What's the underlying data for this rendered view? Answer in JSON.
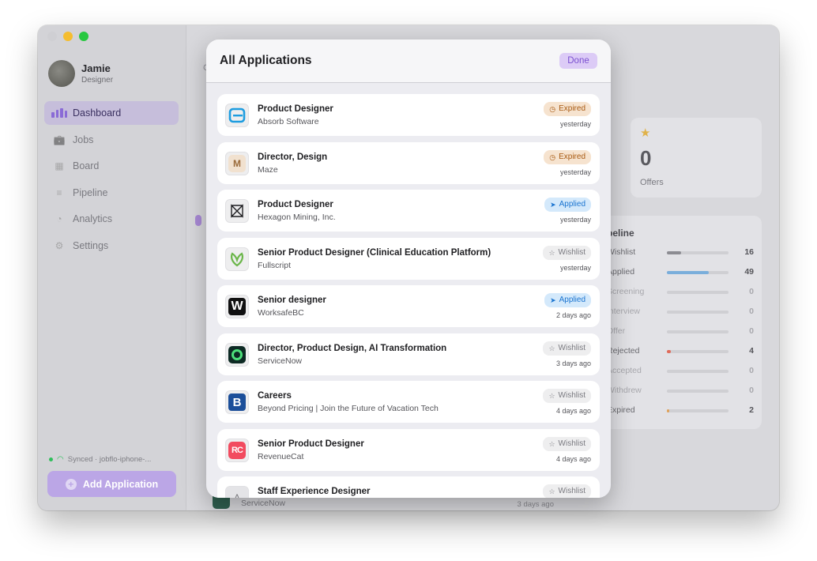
{
  "user": {
    "name": "Jamie",
    "role": "Designer"
  },
  "nav": [
    {
      "label": "Dashboard",
      "icon": "dashboard-icon",
      "active": true
    },
    {
      "label": "Jobs",
      "icon": "briefcase-icon"
    },
    {
      "label": "Board",
      "icon": "board-icon"
    },
    {
      "label": "Pipeline",
      "icon": "pipeline-icon"
    },
    {
      "label": "Analytics",
      "icon": "pie-chart-icon"
    },
    {
      "label": "Settings",
      "icon": "gear-icon"
    }
  ],
  "sync": {
    "text": "Synced · jobflo-iphone-..."
  },
  "add_button": {
    "label": "Add Application"
  },
  "background": {
    "offers": {
      "value": "0",
      "label": "Offers"
    },
    "pipeline": {
      "title": "peline",
      "rows": [
        {
          "label": "Wishlist",
          "value": "16",
          "fraction": 0.23,
          "color": "#8c8c92"
        },
        {
          "label": "Applied",
          "value": "49",
          "fraction": 0.68,
          "color": "#7aaedb"
        },
        {
          "label": "Screening",
          "value": "0",
          "fraction": 0,
          "color": "#8c8c92",
          "dim": true
        },
        {
          "label": "Interview",
          "value": "0",
          "fraction": 0,
          "color": "#8c8c92",
          "dim": true
        },
        {
          "label": "Offer",
          "value": "0",
          "fraction": 0,
          "color": "#8c8c92",
          "dim": true
        },
        {
          "label": "Rejected",
          "value": "4",
          "fraction": 0.06,
          "color": "#e06b5a"
        },
        {
          "label": "Accepted",
          "value": "0",
          "fraction": 0,
          "color": "#8c8c92",
          "dim": true
        },
        {
          "label": "Withdrew",
          "value": "0",
          "fraction": 0,
          "color": "#8c8c92",
          "dim": true
        },
        {
          "label": "Expired",
          "value": "2",
          "fraction": 0.04,
          "color": "#e0a25a"
        }
      ]
    },
    "bottom_row": {
      "company": "ServiceNow",
      "time": "3 days ago"
    }
  },
  "modal": {
    "title": "All Applications",
    "done_label": "Done",
    "applications": [
      {
        "title": "Product Designer",
        "company": "Absorb Software",
        "status": "Expired",
        "status_type": "expired",
        "time": "yesterday",
        "logo": "absorb"
      },
      {
        "title": "Director, Design",
        "company": "Maze",
        "status": "Expired",
        "status_type": "expired",
        "time": "yesterday",
        "logo": "maze"
      },
      {
        "title": "Product Designer",
        "company": "Hexagon Mining, Inc.",
        "status": "Applied",
        "status_type": "applied",
        "time": "yesterday",
        "logo": "hexagon"
      },
      {
        "title": "Senior Product Designer (Clinical Education Platform)",
        "company": "Fullscript",
        "status": "Wishlist",
        "status_type": "wishlist",
        "time": "yesterday",
        "logo": "fullscript"
      },
      {
        "title": "Senior designer",
        "company": "WorksafeBC",
        "status": "Applied",
        "status_type": "applied",
        "time": "2 days ago",
        "logo": "worksafe"
      },
      {
        "title": "Director, Product Design, AI Transformation",
        "company": "ServiceNow",
        "status": "Wishlist",
        "status_type": "wishlist",
        "time": "3 days ago",
        "logo": "servicenow"
      },
      {
        "title": "Careers",
        "company": "Beyond Pricing | Join the Future of Vacation Tech",
        "status": "Wishlist",
        "status_type": "wishlist",
        "time": "4 days ago",
        "logo": "beyond"
      },
      {
        "title": "Senior Product Designer",
        "company": "RevenueCat",
        "status": "Wishlist",
        "status_type": "wishlist",
        "time": "4 days ago",
        "logo": "revenuecat"
      },
      {
        "title": "Staff Experience Designer",
        "company": "",
        "status": "Wishlist",
        "status_type": "wishlist",
        "time": "",
        "logo": "generic"
      }
    ]
  }
}
